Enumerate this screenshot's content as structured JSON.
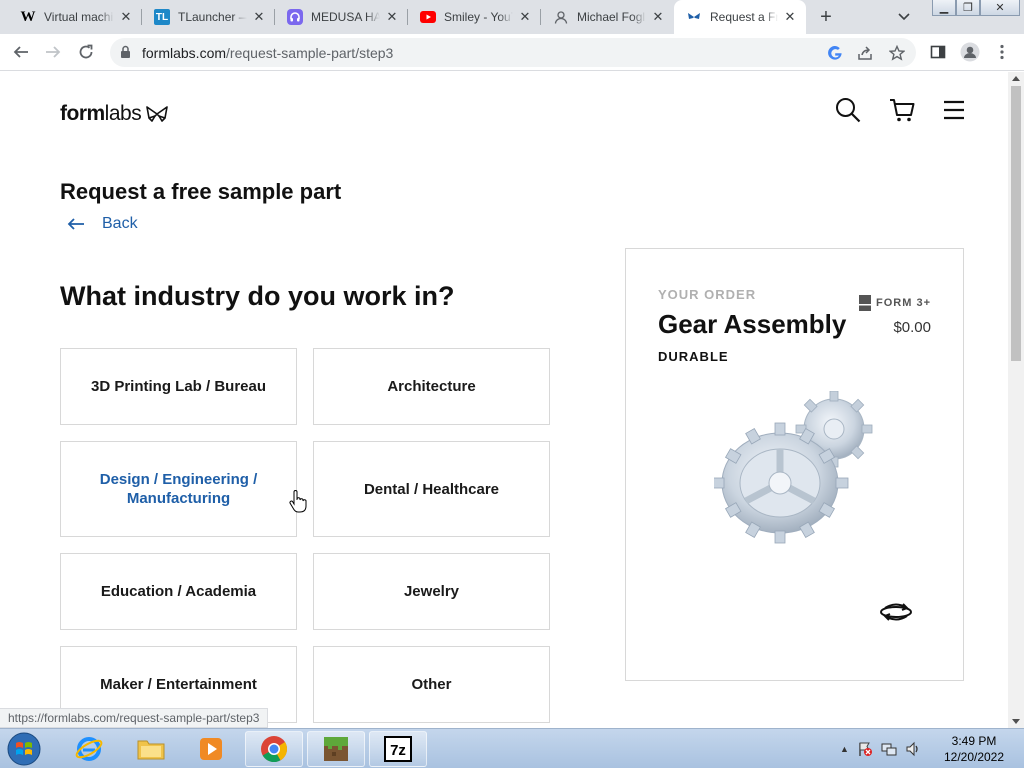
{
  "browser": {
    "tabs": [
      {
        "favicon": "W",
        "title": "Virtual machine",
        "active": false
      },
      {
        "favicon": "TL",
        "title": "TLauncher — Minecraft",
        "active": false
      },
      {
        "favicon": "headset-icon",
        "title": "MEDUSA HA",
        "active": false
      },
      {
        "favicon": "youtube-icon",
        "title": "Smiley - YouTube",
        "active": false
      },
      {
        "favicon": "person-icon",
        "title": "Michael Fogl",
        "active": false
      },
      {
        "favicon": "formlabs-butterfly-icon",
        "title": "Request a Free",
        "active": true
      }
    ],
    "url_host": "formlabs.com",
    "url_path": "/request-sample-part/step3",
    "status_url": "https://formlabs.com/request-sample-part/step3"
  },
  "site": {
    "logo_bold": "form",
    "logo_light": "labs",
    "page_title": "Request a free sample part",
    "back_label": "Back",
    "question": "What industry do you work in?",
    "options": [
      "3D Printing Lab / Bureau",
      "Architecture",
      "Design / Engineering / Manufacturing",
      "Dental / Healthcare",
      "Education / Academia",
      "Jewelry",
      "Maker / Entertainment",
      "Other"
    ],
    "order": {
      "eyebrow": "YOUR ORDER",
      "printer": "FORM 3+",
      "part_name": "Gear Assembly",
      "price": "$0.00",
      "material": "DURABLE"
    }
  },
  "taskbar": {
    "apps": [
      "internet-explorer",
      "file-explorer",
      "media-player",
      "chrome",
      "minecraft",
      "7zip"
    ],
    "time": "3:49 PM",
    "date": "12/20/2022"
  }
}
